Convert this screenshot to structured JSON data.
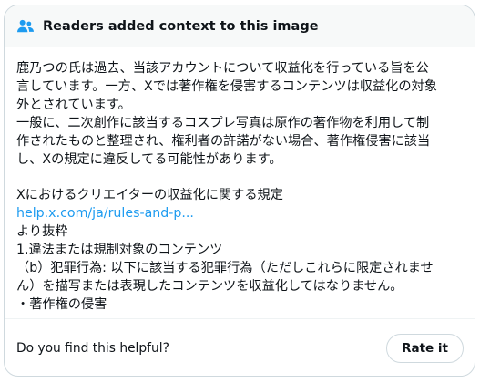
{
  "header": {
    "icon": "people-icon",
    "title": "Readers added context to this image",
    "accent_color": "#1d9bf0"
  },
  "note": {
    "lines": [
      "鹿乃つの氏は過去、当該アカウントについて収益化を行っている旨を公",
      "言しています。一方、Xでは著作権を侵害するコンテンツは収益化の対象",
      "外とされています。",
      "一般に、二次創作に該当するコスプレ写真は原作の著作物を利用して制",
      "作されたものと整理され、権利者の許諾がない場合、著作権侵害に該当",
      "し、Xの規定に違反してる可能性があります。"
    ],
    "source_title": "Xにおけるクリエイターの収益化に関する規定",
    "link_text": "help.x.com/ja/rules-and-p...",
    "excerpt_lines": [
      "より抜粋",
      "1.違法または規制対象のコンテンツ",
      "（b）犯罪行為: 以下に該当する犯罪行為（ただしこれらに限定されませ",
      "ん）を描写または表現したコンテンツを収益化してはなりません。",
      "・著作権の侵害"
    ]
  },
  "footer": {
    "question": "Do you find this helpful?",
    "rate_label": "Rate it"
  }
}
